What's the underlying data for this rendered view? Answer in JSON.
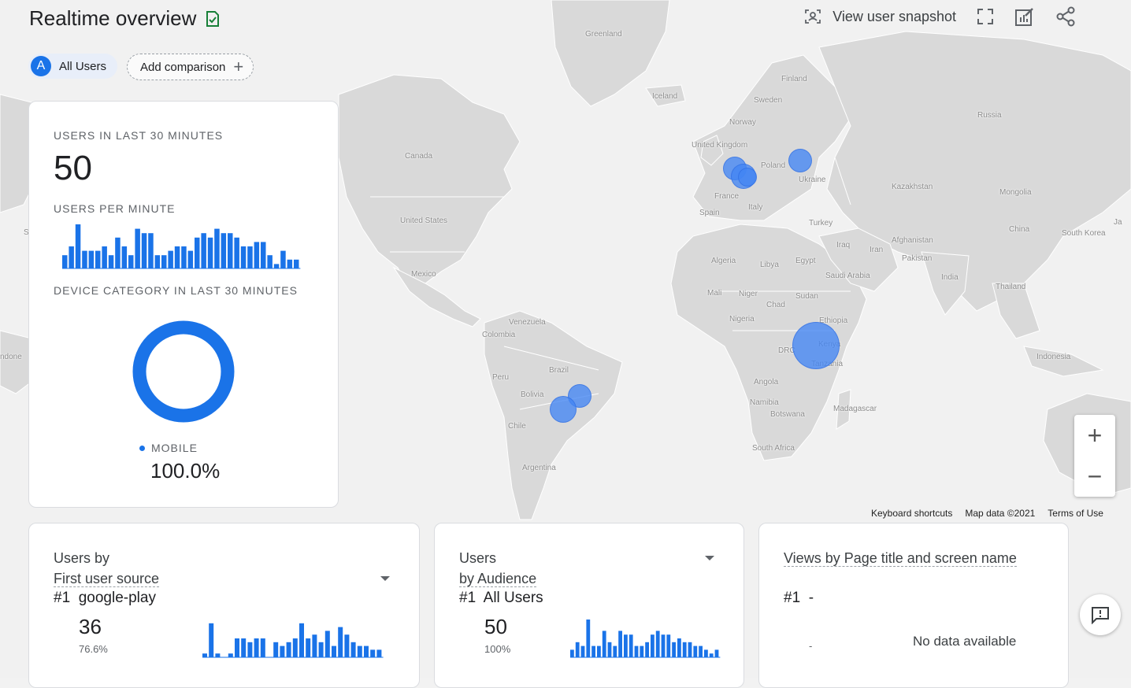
{
  "header": {
    "title": "Realtime overview",
    "snapshot_label": "View user snapshot"
  },
  "chips": {
    "users_avatar": "A",
    "users_label": "All Users",
    "compare_label": "Add comparison"
  },
  "summary": {
    "users_label": "USERS IN LAST 30 MINUTES",
    "users_value": "50",
    "per_minute_label": "USERS PER MINUTE",
    "per_minute_bars": [
      0.3,
      0.5,
      1.0,
      0.4,
      0.4,
      0.4,
      0.5,
      0.3,
      0.7,
      0.5,
      0.3,
      0.9,
      0.8,
      0.8,
      0.3,
      0.3,
      0.4,
      0.5,
      0.5,
      0.4,
      0.7,
      0.8,
      0.7,
      0.9,
      0.8,
      0.8,
      0.7,
      0.5,
      0.5,
      0.6,
      0.6,
      0.3,
      0.1,
      0.4,
      0.2,
      0.2
    ],
    "device_label": "DEVICE CATEGORY IN LAST 30 MINUTES",
    "device_category": "MOBILE",
    "device_percent": "100.0%"
  },
  "card_source": {
    "title_line1": "Users by",
    "title_line2": "First user source",
    "rank": "#1",
    "top_item": "google-play",
    "value": "36",
    "percent": "76.6%",
    "bars": [
      0.1,
      0.9,
      0.1,
      0,
      0.1,
      0.5,
      0.5,
      0.4,
      0.5,
      0.5,
      0,
      0.4,
      0.3,
      0.4,
      0.5,
      0.9,
      0.5,
      0.6,
      0.4,
      0.7,
      0.3,
      0.8,
      0.6,
      0.4,
      0.3,
      0.3,
      0.2,
      0.2
    ]
  },
  "card_audience": {
    "title_line1": "Users",
    "title_line2": "by Audience",
    "rank": "#1",
    "top_item": "All Users",
    "value": "50",
    "percent": "100%",
    "bars": [
      0.2,
      0.4,
      0.3,
      1.0,
      0.3,
      0.3,
      0.7,
      0.4,
      0.3,
      0.7,
      0.6,
      0.6,
      0.3,
      0.3,
      0.4,
      0.6,
      0.7,
      0.6,
      0.6,
      0.4,
      0.5,
      0.4,
      0.4,
      0.3,
      0.3,
      0.2,
      0.1,
      0.2
    ]
  },
  "card_views": {
    "title": "Views by Page title and screen name",
    "rank": "#1",
    "top_item": "-",
    "side_value": "-",
    "no_data": "No data available"
  },
  "map": {
    "labels": [
      "Greenland",
      "Iceland",
      "Finland",
      "Sweden",
      "Norway",
      "Russia",
      "United Kingdom",
      "Poland",
      "Ukraine",
      "France",
      "Italy",
      "Spain",
      "Kazakhstan",
      "Mongolia",
      "Canada",
      "United States",
      "Turkey",
      "Iraq",
      "Iran",
      "Afghanistan",
      "Pakistan",
      "China",
      "South Korea",
      "Algeria",
      "Libya",
      "Egypt",
      "Saudi Arabia",
      "India",
      "Thailand",
      "Mali",
      "Niger",
      "Chad",
      "Sudan",
      "Nigeria",
      "Ethiopia",
      "Mexico",
      "Venezuela",
      "Colombia",
      "Brazil",
      "Peru",
      "Bolivia",
      "Chile",
      "Argentina",
      "DRC",
      "Kenya",
      "Tanzania",
      "Angola",
      "Namibia",
      "Botswana",
      "Madagascar",
      "South Africa",
      "Indonesia",
      "Ja",
      "South Atla",
      "ndone"
    ],
    "footer": [
      "Keyboard shortcuts",
      "Map data ©2021",
      "Terms of Use"
    ],
    "bubble_color": "#4285f4"
  },
  "colors": {
    "accent": "#1a73e8",
    "card_border": "#dadce0"
  },
  "icons": [
    "check-badge-icon",
    "snapshot-icon",
    "fullscreen-icon",
    "edit-report-icon",
    "share-icon",
    "plus-icon",
    "dropdown-icon",
    "zoom-in-icon",
    "zoom-out-icon",
    "feedback-icon"
  ]
}
